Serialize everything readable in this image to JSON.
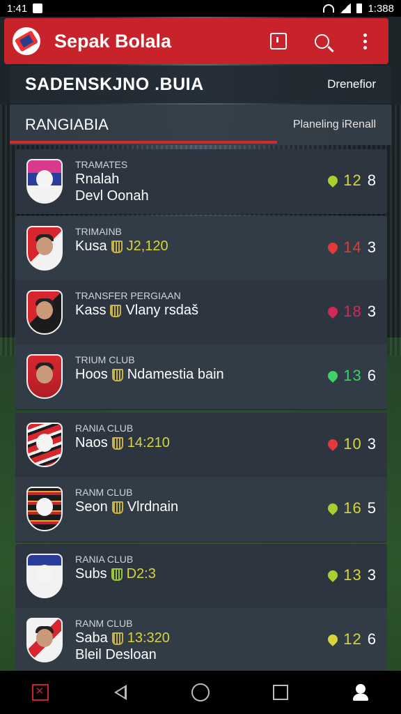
{
  "status": {
    "time": "1:41",
    "battery": "1:388"
  },
  "app": {
    "title": "Sepak Bolala"
  },
  "section": {
    "title": "SADENSKJNO .BUIA",
    "action": "Drenefior"
  },
  "tab": {
    "title": "RANGIABIA",
    "action": "Planeling iRenall"
  },
  "rows": [
    {
      "label": "TRAMATES",
      "line1": "Rnalah",
      "extra": "",
      "line2": "Devl Oonah",
      "score_a": "12",
      "score_b": "8",
      "pin_color": "#a7cf2e",
      "score_color": "#d8d43a",
      "badge": "crest-pink",
      "trophy": ""
    },
    {
      "label": "TRIMAINB",
      "line1": "Kusa",
      "extra": "J2,120",
      "line2": "",
      "score_a": "14",
      "score_b": "3",
      "pin_color": "#e23a3a",
      "score_color": "#e23a3a",
      "badge": "player-1",
      "trophy": "gold"
    },
    {
      "label": "TRANSFER PERGIAAN",
      "line1": "Kass",
      "extra": "Vlany rsdaš",
      "line2": "",
      "score_a": "18",
      "score_b": "3",
      "pin_color": "#d12a5a",
      "score_color": "#d12a5a",
      "badge": "player-2",
      "trophy": "gold"
    },
    {
      "label": "TRIUM CLUB",
      "line1": "Hoos",
      "extra": "Ndamestia bain",
      "line2": "",
      "score_a": "13",
      "score_b": "6",
      "pin_color": "#3fd06a",
      "score_color": "#3fd06a",
      "badge": "player-3",
      "trophy": "gold"
    },
    {
      "label": "RANIA CLUB",
      "line1": "Naos",
      "extra": "14:210",
      "line2": "",
      "score_a": "10",
      "score_b": "3",
      "pin_color": "#e23a3a",
      "score_color": "#d8d43a",
      "badge": "crest-red",
      "trophy": "gold"
    },
    {
      "label": "RANM CLUB",
      "line1": "Seon",
      "extra": "Vlrdnain",
      "line2": "",
      "score_a": "16",
      "score_b": "5",
      "pin_color": "#a7cf2e",
      "score_color": "#d8d43a",
      "badge": "crest-black",
      "trophy": "gold"
    },
    {
      "label": "RANIA CLUB",
      "line1": "Subs",
      "extra": "D2:3",
      "line2": "",
      "score_a": "13",
      "score_b": "3",
      "pin_color": "#a7cf2e",
      "score_color": "#d8d43a",
      "badge": "crest-blue",
      "trophy": "green"
    },
    {
      "label": "RANM CLUB",
      "line1": "Saba",
      "extra": "13:320",
      "line2": "Bleil Desloan",
      "score_a": "12",
      "score_b": "6",
      "pin_color": "#d8d43a",
      "score_color": "#d8d43a",
      "badge": "player-4",
      "trophy": "gold"
    }
  ]
}
